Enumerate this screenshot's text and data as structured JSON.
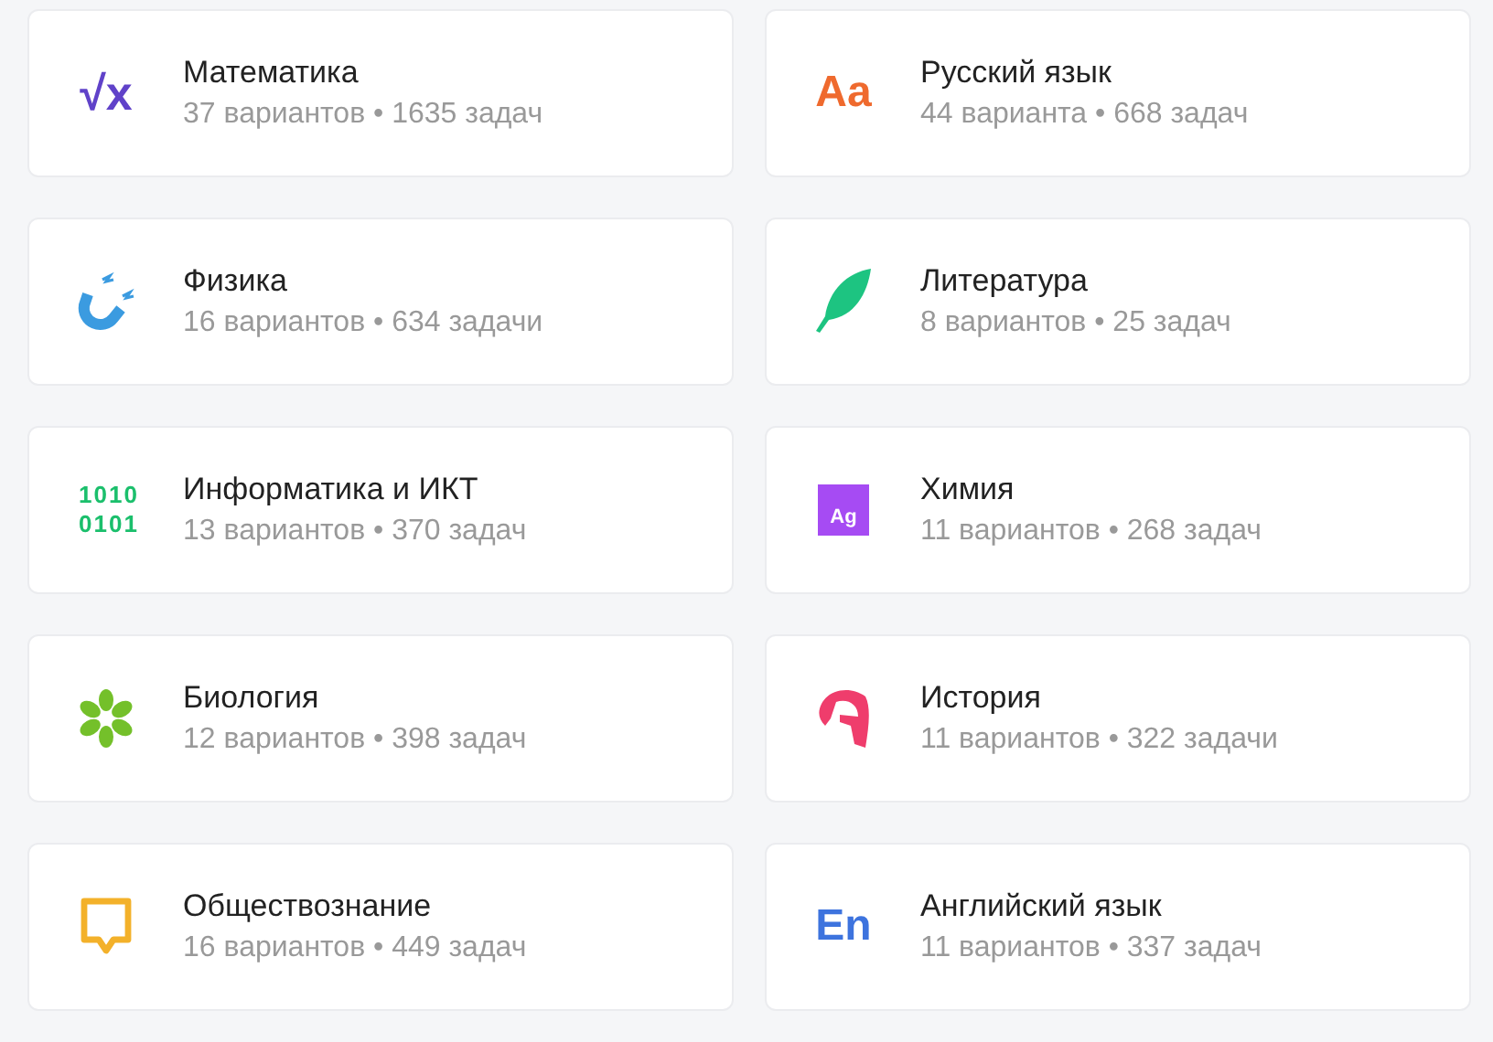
{
  "subjects": [
    {
      "kind": "math",
      "glyph": "√x",
      "title": "Математика",
      "meta": "37 вариантов • 1635 задач"
    },
    {
      "kind": "russian",
      "glyph": "Aa",
      "title": "Русский язык",
      "meta": "44 варианта • 668 задач"
    },
    {
      "kind": "physics",
      "title": "Физика",
      "meta": "16 вариантов • 634 задачи"
    },
    {
      "kind": "literature",
      "title": "Литература",
      "meta": "8 вариантов • 25 задач"
    },
    {
      "kind": "informatics",
      "glyph": "1010 0101",
      "title": "Информатика и ИКТ",
      "meta": "13 вариантов • 370 задач"
    },
    {
      "kind": "chemistry",
      "glyph": "Ag",
      "title": "Химия",
      "meta": "11 вариантов • 268 задач"
    },
    {
      "kind": "biology",
      "title": "Биология",
      "meta": "12 вариантов • 398 задач"
    },
    {
      "kind": "history",
      "title": "История",
      "meta": "11 вариантов • 322 задачи"
    },
    {
      "kind": "social",
      "title": "Обществознание",
      "meta": "16 вариантов • 449 задач"
    },
    {
      "kind": "english",
      "glyph": "En",
      "title": "Английский язык",
      "meta": "11 вариантов • 337 задач"
    }
  ]
}
